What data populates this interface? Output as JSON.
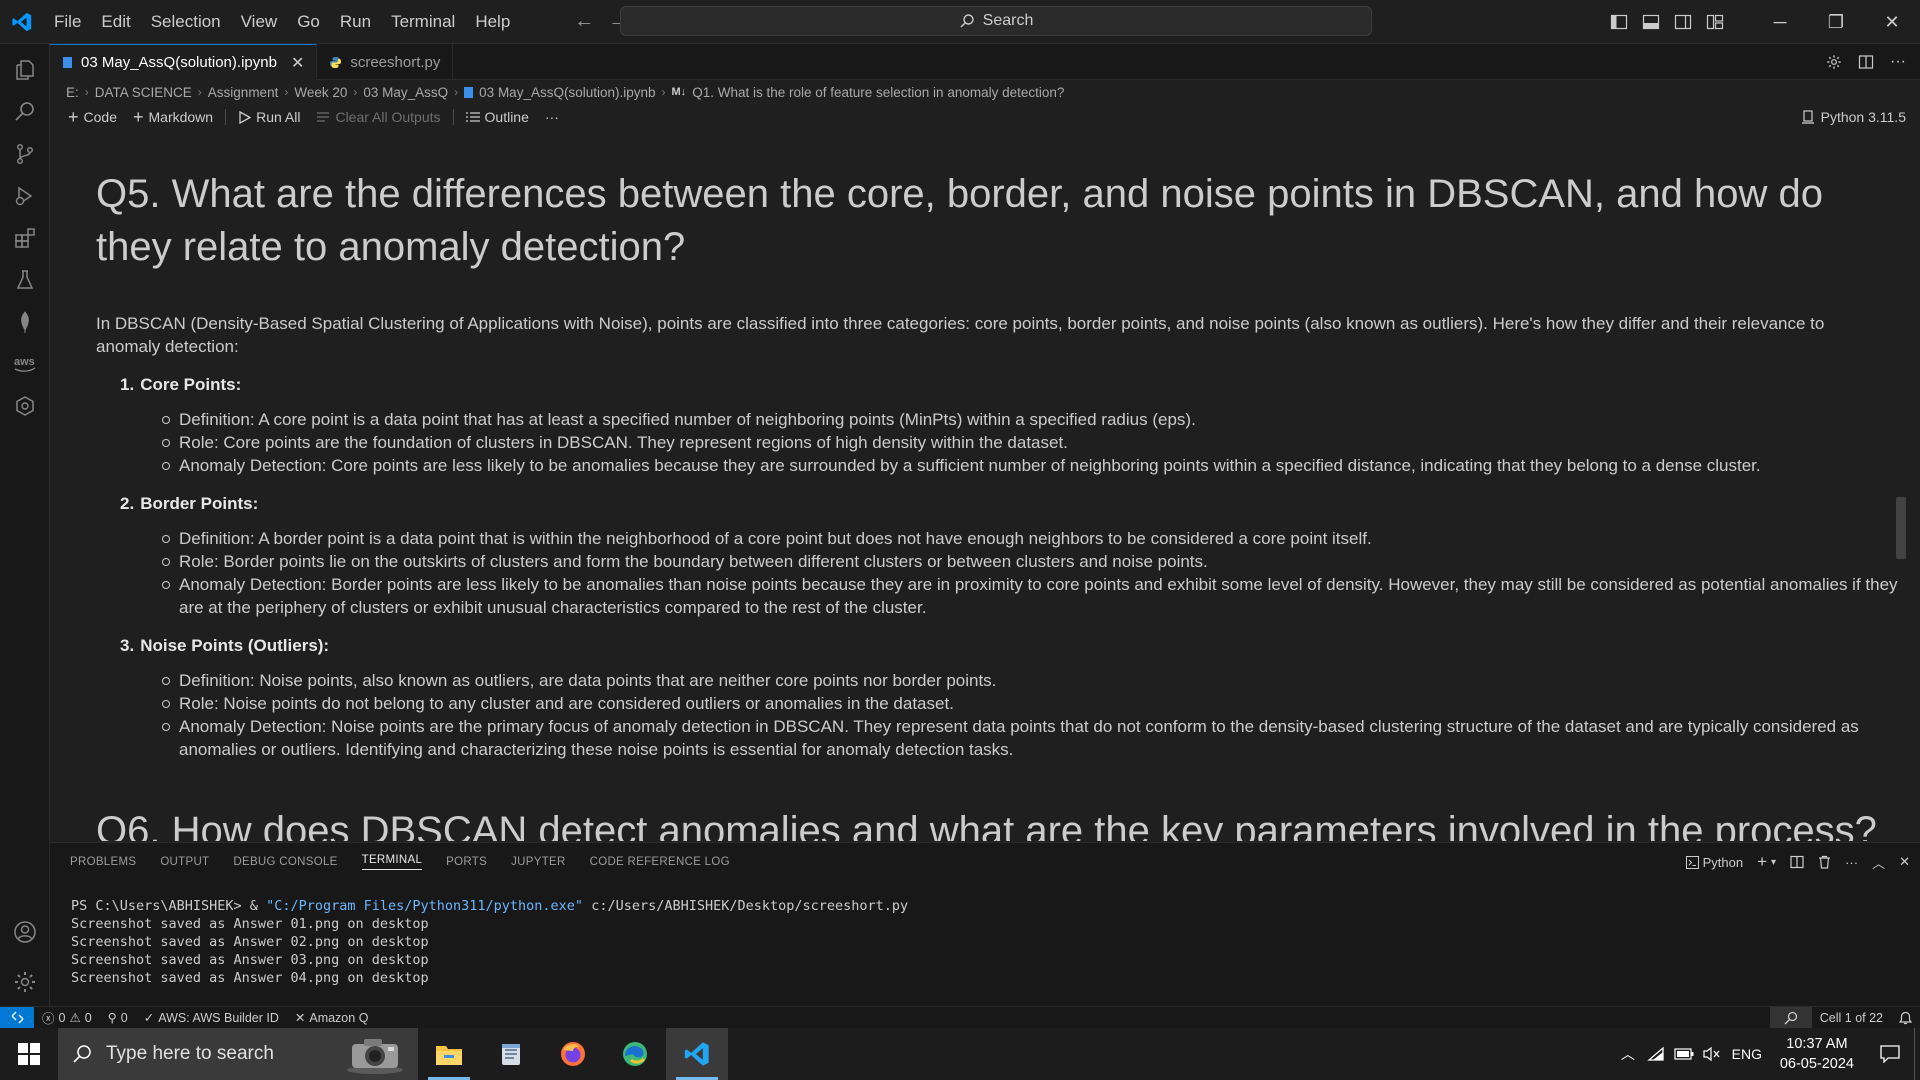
{
  "titlebar": {
    "menu": [
      "File",
      "Edit",
      "Selection",
      "View",
      "Go",
      "Run",
      "Terminal",
      "Help"
    ],
    "search_placeholder": "Search",
    "accent": "#0078d4"
  },
  "tabs": [
    {
      "label": "03 May_AssQ(solution).ipynb",
      "icon": "notebook-icon"
    },
    {
      "label": "screeshort.py",
      "icon": "python-file-icon"
    }
  ],
  "breadcrumb": [
    "E:",
    "DATA SCIENCE",
    "Assignment",
    "Week 20",
    "03 May_AssQ",
    "03 May_AssQ(solution).ipynb",
    "Q1. What is the role of feature selection in anomaly detection?"
  ],
  "breadcrumb_md_badge": "M↓",
  "toolbar": {
    "code": "Code",
    "markdown": "Markdown",
    "run_all": "Run All",
    "clear_outputs": "Clear All Outputs",
    "outline": "Outline",
    "more": "···",
    "kernel": "Python 3.11.5"
  },
  "notebook": {
    "heading": "Q5. What are the differences between the core, border, and noise points in DBSCAN, and how do they relate to anomaly detection?",
    "intro": "In DBSCAN (Density-Based Spatial Clustering of Applications with Noise), points are classified into three categories: core points, border points, and noise points (also known as outliers). Here's how they differ and their relevance to anomaly detection:",
    "sections": [
      {
        "num": "1.",
        "title": "Core Points:",
        "items": [
          "Definition: A core point is a data point that has at least a specified number of neighboring points (MinPts) within a specified radius (eps).",
          "Role: Core points are the foundation of clusters in DBSCAN. They represent regions of high density within the dataset.",
          "Anomaly Detection: Core points are less likely to be anomalies because they are surrounded by a sufficient number of neighboring points within a specified distance, indicating that they belong to a dense cluster."
        ]
      },
      {
        "num": "2.",
        "title": "Border Points:",
        "items": [
          "Definition: A border point is a data point that is within the neighborhood of a core point but does not have enough neighbors to be considered a core point itself.",
          "Role: Border points lie on the outskirts of clusters and form the boundary between different clusters or between clusters and noise points.",
          "Anomaly Detection: Border points are less likely to be anomalies than noise points because they are in proximity to core points and exhibit some level of density. However, they may still be considered as potential anomalies if they are at the periphery of clusters or exhibit unusual characteristics compared to the rest of the cluster."
        ]
      },
      {
        "num": "3.",
        "title": "Noise Points (Outliers):",
        "items": [
          "Definition: Noise points, also known as outliers, are data points that are neither core points nor border points.",
          "Role: Noise points do not belong to any cluster and are considered outliers or anomalies in the dataset.",
          "Anomaly Detection: Noise points are the primary focus of anomaly detection in DBSCAN. They represent data points that do not conform to the density-based clustering structure of the dataset and are typically considered as anomalies or outliers. Identifying and characterizing these noise points is essential for anomaly detection tasks."
        ]
      }
    ],
    "next_heading": "Q6. How does DBSCAN detect anomalies and what are the key parameters involved in the process?"
  },
  "panel": {
    "tabs": [
      "PROBLEMS",
      "OUTPUT",
      "DEBUG CONSOLE",
      "TERMINAL",
      "PORTS",
      "JUPYTER",
      "CODE REFERENCE LOG"
    ],
    "active_tab": "TERMINAL",
    "shell_label": "Python",
    "terminal": {
      "prompt": "PS C:\\Users\\ABHISHEK> & ",
      "exe": "\"C:/Program Files/Python311/python.exe\"",
      "arg": " c:/Users/ABHISHEK/Desktop/screeshort.py",
      "lines": [
        "Screenshot saved as Answer 01.png on desktop",
        "Screenshot saved as Answer 02.png on desktop",
        "Screenshot saved as Answer 03.png on desktop",
        "Screenshot saved as Answer 04.png on desktop"
      ]
    }
  },
  "statusbar": {
    "errors": "0",
    "warnings": "0",
    "ports": "0",
    "aws": "AWS: AWS Builder ID",
    "amazonq": "Amazon Q",
    "cell": "Cell 1 of 22"
  },
  "taskbar": {
    "search_placeholder": "Type here to search",
    "lang": "ENG",
    "time": "10:37 AM",
    "date": "06-05-2024"
  }
}
